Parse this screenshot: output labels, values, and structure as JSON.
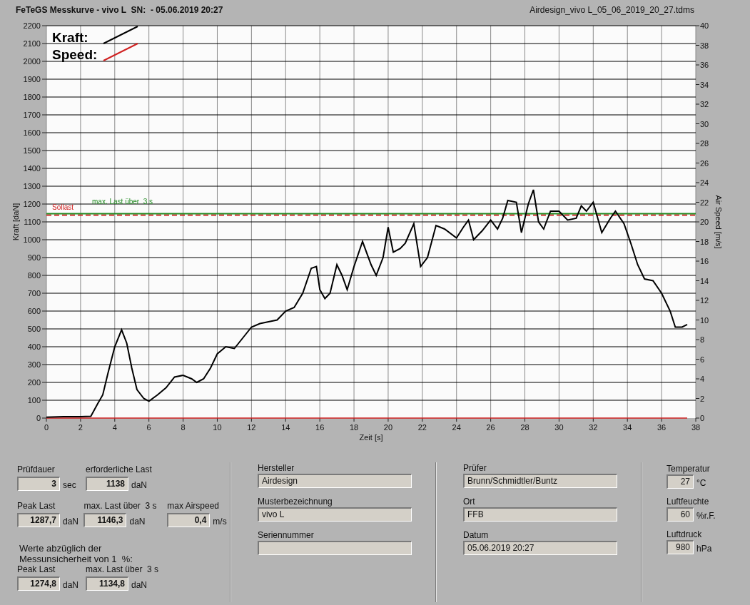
{
  "window": {
    "title": "FeTeGS Messkurve - vivo L  SN:  - 05.06.2019 20:27",
    "file": "Airdesign_vivo L_05_06_2019_20_27.tdms"
  },
  "chart": {
    "chart_data": {
      "type": "line",
      "xlabel": "Zeit [s]",
      "ylabel": "Kraft [daN]",
      "y2label": "Air Speed [m/s]",
      "x": [
        0,
        1,
        2,
        2.6,
        3,
        3.3,
        3.6,
        4,
        4.4,
        4.7,
        5,
        5.3,
        5.7,
        6,
        6.5,
        7,
        7.5,
        8,
        8.5,
        8.8,
        9.2,
        9.6,
        10,
        10.5,
        11,
        11.5,
        12,
        12.5,
        13,
        13.5,
        14,
        14.5,
        15,
        15.5,
        15.8,
        16,
        16.3,
        16.6,
        17,
        17.3,
        17.6,
        18,
        18.5,
        19,
        19.3,
        19.7,
        20,
        20.3,
        20.7,
        21,
        21.5,
        21.9,
        22.3,
        22.8,
        23.3,
        24,
        24.4,
        24.7,
        25,
        25.5,
        26,
        26.4,
        26.7,
        27,
        27.5,
        27.8,
        28.2,
        28.5,
        28.8,
        29.1,
        29.5,
        30,
        30.5,
        31,
        31.3,
        31.6,
        32,
        32.5,
        33,
        33.3,
        33.8,
        34.2,
        34.6,
        35,
        35.5,
        36,
        36.5,
        36.8,
        37.2,
        37.5
      ],
      "series": [
        {
          "name": "Kraft:",
          "color": "#000000",
          "values": [
            5,
            8,
            8,
            10,
            80,
            130,
            250,
            400,
            495,
            420,
            280,
            160,
            110,
            95,
            130,
            170,
            230,
            240,
            220,
            200,
            220,
            280,
            360,
            400,
            390,
            450,
            510,
            530,
            540,
            550,
            600,
            620,
            700,
            840,
            850,
            720,
            670,
            700,
            860,
            800,
            720,
            850,
            990,
            860,
            800,
            900,
            1070,
            930,
            950,
            980,
            1090,
            850,
            900,
            1080,
            1060,
            1010,
            1070,
            1110,
            1000,
            1050,
            1110,
            1060,
            1120,
            1220,
            1210,
            1040,
            1200,
            1280,
            1100,
            1060,
            1160,
            1160,
            1110,
            1120,
            1190,
            1160,
            1210,
            1040,
            1120,
            1160,
            1090,
            980,
            860,
            780,
            770,
            700,
            600,
            510,
            510,
            525
          ]
        },
        {
          "name": "Speed:",
          "color": "#d02020",
          "axis": "y2",
          "values": [
            0,
            0,
            0,
            0,
            0,
            0,
            0,
            0,
            0,
            0,
            0,
            0,
            0,
            0,
            0,
            0,
            0,
            0,
            0,
            0,
            0,
            0,
            0,
            0,
            0,
            0,
            0,
            0,
            0,
            0,
            0,
            0,
            0,
            0,
            0,
            0,
            0,
            0,
            0,
            0,
            0,
            0,
            0,
            0,
            0,
            0,
            0,
            0,
            0,
            0,
            0,
            0,
            0,
            0,
            0,
            0,
            0,
            0,
            0,
            0,
            0,
            0,
            0,
            0,
            0,
            0,
            0,
            0,
            0,
            0,
            0,
            0,
            0,
            0,
            0,
            0,
            0,
            0,
            0,
            0,
            0,
            0,
            0,
            0,
            0,
            0,
            0,
            0,
            0,
            0
          ]
        }
      ],
      "grid": true,
      "legend": "upper left",
      "xlim": [
        0,
        38
      ],
      "ylim": [
        0,
        2200
      ],
      "y2lim": [
        0,
        40
      ],
      "xticks": [
        0,
        2,
        4,
        6,
        8,
        10,
        12,
        14,
        16,
        18,
        20,
        22,
        24,
        26,
        28,
        30,
        32,
        34,
        36,
        38
      ],
      "yticks": [
        0,
        100,
        200,
        300,
        400,
        500,
        600,
        700,
        800,
        900,
        1000,
        1100,
        1200,
        1300,
        1400,
        1500,
        1600,
        1700,
        1800,
        1900,
        2000,
        2100,
        2200
      ],
      "y2ticks": [
        0,
        2,
        4,
        6,
        8,
        10,
        12,
        14,
        16,
        18,
        20,
        22,
        24,
        26,
        28,
        30,
        32,
        34,
        36,
        38,
        40
      ],
      "ref_lines": [
        {
          "axis": "y",
          "value": 1138,
          "label": "Sollast"
        },
        {
          "axis": "y",
          "value": 1146,
          "label": "max. Last über  3 s"
        }
      ]
    }
  },
  "results": {
    "rows": [
      [
        {
          "label": "Prüfdauer",
          "value": "3",
          "unit": "sec"
        },
        {
          "label": "erforderliche Last",
          "value": "1138",
          "unit": "daN"
        }
      ],
      [
        {
          "label": "Peak Last",
          "value": "1287,7",
          "unit": "daN"
        },
        {
          "label": "max. Last über  3 s",
          "value": "1146,3",
          "unit": "daN"
        },
        {
          "label": "max Airspeed",
          "value": "0,4",
          "unit": "m/s"
        }
      ]
    ],
    "note": [
      "Werte abzüglich der",
      "Messunsicherheit von 1  %:"
    ],
    "corrected": [
      {
        "label": "Peak Last",
        "value": "1274,8",
        "unit": "daN"
      },
      {
        "label": "max. Last über  3 s",
        "value": "1134,8",
        "unit": "daN"
      }
    ]
  },
  "specimen": [
    {
      "label": "Hersteller",
      "value": "Airdesign"
    },
    {
      "label": "Musterbezeichnung",
      "value": "vivo L"
    },
    {
      "label": "Seriennummer"
    }
  ],
  "inspection": [
    {
      "label": "Prüfer",
      "value": "Brunn/Schmidtler/Buntz"
    },
    {
      "label": "Ort",
      "value": "FFB"
    },
    {
      "label": "Datum",
      "value": "05.06.2019 20:27"
    }
  ],
  "conditions": [
    {
      "label": "Temperatur",
      "value": "27",
      "unit": "°C"
    },
    {
      "label": "Luftfeuchte",
      "value": "60",
      "unit": "%r.F."
    },
    {
      "label": "Luftdruck",
      "value": "980",
      "unit": "hPa"
    }
  ]
}
